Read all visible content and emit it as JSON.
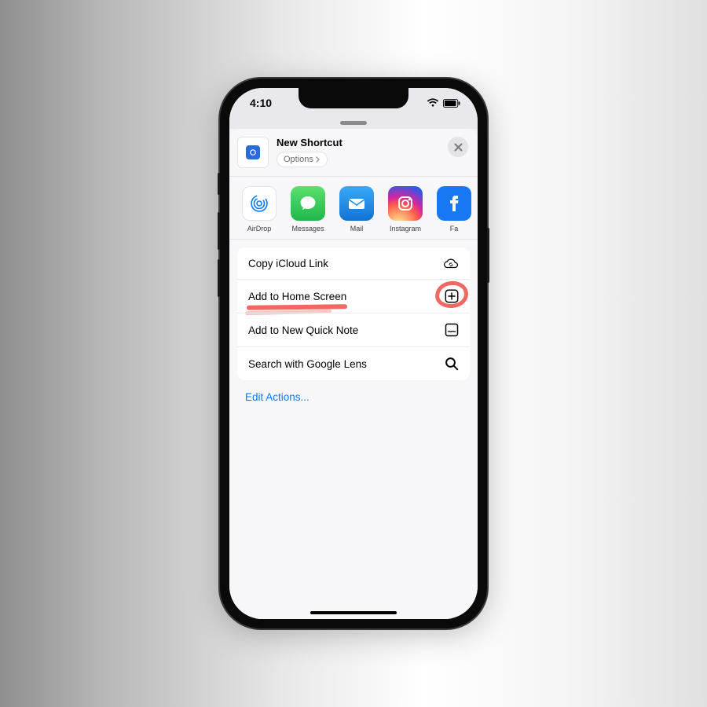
{
  "status": {
    "time": "4:10"
  },
  "header": {
    "title": "New Shortcut",
    "options_label": "Options"
  },
  "share_targets": [
    {
      "label": "AirDrop"
    },
    {
      "label": "Messages"
    },
    {
      "label": "Mail"
    },
    {
      "label": "Instagram"
    },
    {
      "label": "Fa"
    }
  ],
  "actions": [
    {
      "label": "Copy iCloud Link",
      "icon": "cloud-link-icon"
    },
    {
      "label": "Add to Home Screen",
      "icon": "plus-square-icon",
      "highlighted": true
    },
    {
      "label": "Add to New Quick Note",
      "icon": "note-icon"
    },
    {
      "label": "Search with Google Lens",
      "icon": "search-icon"
    }
  ],
  "edit_actions_label": "Edit Actions..."
}
